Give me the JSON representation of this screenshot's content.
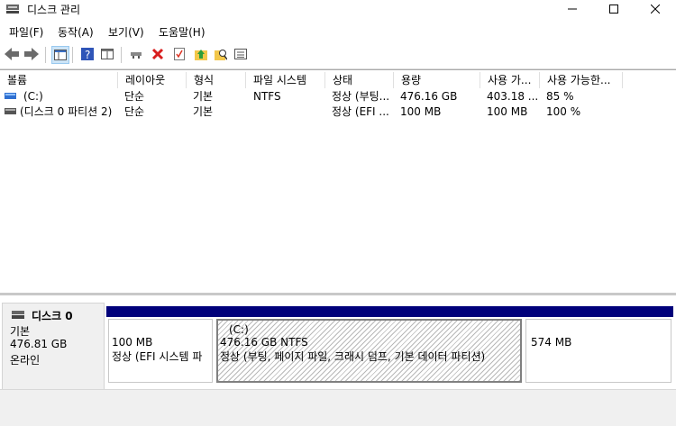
{
  "window": {
    "title": "디스크 관리"
  },
  "menu": [
    "파일(F)",
    "동작(A)",
    "보기(V)",
    "도움말(H)"
  ],
  "columns": [
    "볼륨",
    "레이아웃",
    "형식",
    "파일 시스템",
    "상태",
    "용량",
    "사용 가...",
    "사용 가능한..."
  ],
  "volumes": [
    {
      "name": "(C:)",
      "layout": "단순",
      "type": "기본",
      "fs": "NTFS",
      "status": "정상 (부팅...",
      "capacity": "476.16 GB",
      "free": "403.18 ...",
      "free_pct": "85 %"
    },
    {
      "name": "(디스크 0 파티션 2)",
      "layout": "단순",
      "type": "기본",
      "fs": "",
      "status": "정상 (EFI ...",
      "capacity": "100 MB",
      "free": "100 MB",
      "free_pct": "100 %"
    }
  ],
  "disk": {
    "name": "디스크 0",
    "type": "기본",
    "size": "476.81 GB",
    "status": "온라인",
    "partitions": [
      {
        "title": "",
        "size": "100 MB",
        "status": "정상 (EFI 시스템 파"
      },
      {
        "title": "(C:)",
        "size": "476.16 GB NTFS",
        "status": "정상 (부팅, 페이지 파일, 크래시 덤프, 기본 데이터 파티션)"
      },
      {
        "title": "",
        "size": "574 MB",
        "status": ""
      }
    ]
  },
  "colors": {
    "partition_bar": "#00007a",
    "selection_border": "#808080"
  }
}
